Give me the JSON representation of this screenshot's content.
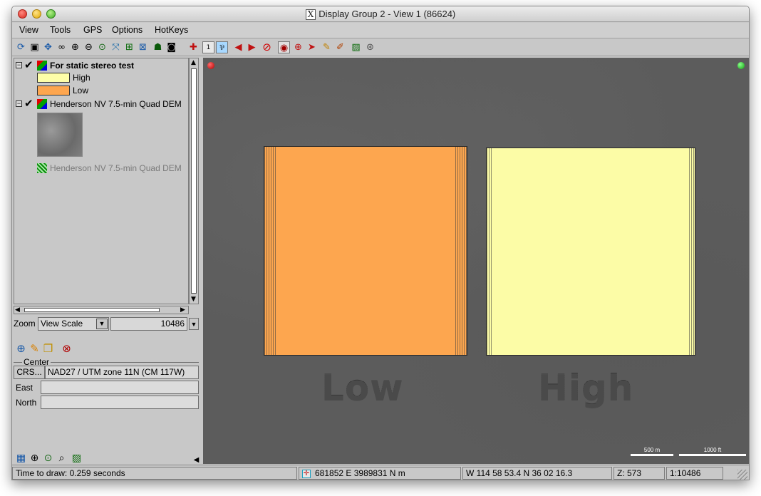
{
  "window": {
    "title": "Display Group 2 - View 1 (86624)"
  },
  "menu": [
    "View",
    "Tools",
    "GPS",
    "Options",
    "HotKeys"
  ],
  "toolbar_icons": [
    "refresh-icon",
    "frame-icon",
    "pan-icon",
    "binoculars-icon",
    "zoom-in-icon",
    "zoom-out-icon",
    "zoom-extent-icon",
    "fit-icon",
    "grid-icon",
    "select-icon",
    "users-icon",
    "camera-icon",
    "add-layer-icon",
    "scale-1-icon",
    "measure-icon",
    "back-icon",
    "forward-icon",
    "stop-icon",
    "target-icon",
    "zoom-red-icon",
    "pointer-icon",
    "pencil-icon",
    "brush-icon",
    "image-icon",
    "gps-icon"
  ],
  "layers": {
    "group1": {
      "name": "For static stereo test",
      "legend": [
        {
          "label": "High",
          "color": "#fefea8"
        },
        {
          "label": "Low",
          "color": "#fda64f"
        }
      ]
    },
    "group2": {
      "name": "Henderson NV 7.5-min Quad DEM"
    },
    "group3": {
      "name": "Henderson NV 7.5-min Quad DEM"
    }
  },
  "zoom": {
    "label": "Zoom",
    "mode": "View Scale",
    "value": "10486"
  },
  "center": {
    "group_label": "Center",
    "crs_button": "CRS...",
    "crs_value": "NAD27 / UTM zone 11N (CM 117W)",
    "east_label": "East",
    "north_label": "North",
    "east_value": "",
    "north_value": ""
  },
  "viewport": {
    "low_label": "Low",
    "high_label": "High",
    "low_color": "#fda64f",
    "high_color": "#fcfca6",
    "scale_metric": "500 m",
    "scale_imperial": "1000 ft"
  },
  "status": {
    "draw_time": "Time to draw: 0.259 seconds",
    "coords": "681852 E  3989831 N m",
    "latlon": "W 114 58 53.4   N 36 02 16.3",
    "z": "Z: 573",
    "scale": "1:10486"
  }
}
